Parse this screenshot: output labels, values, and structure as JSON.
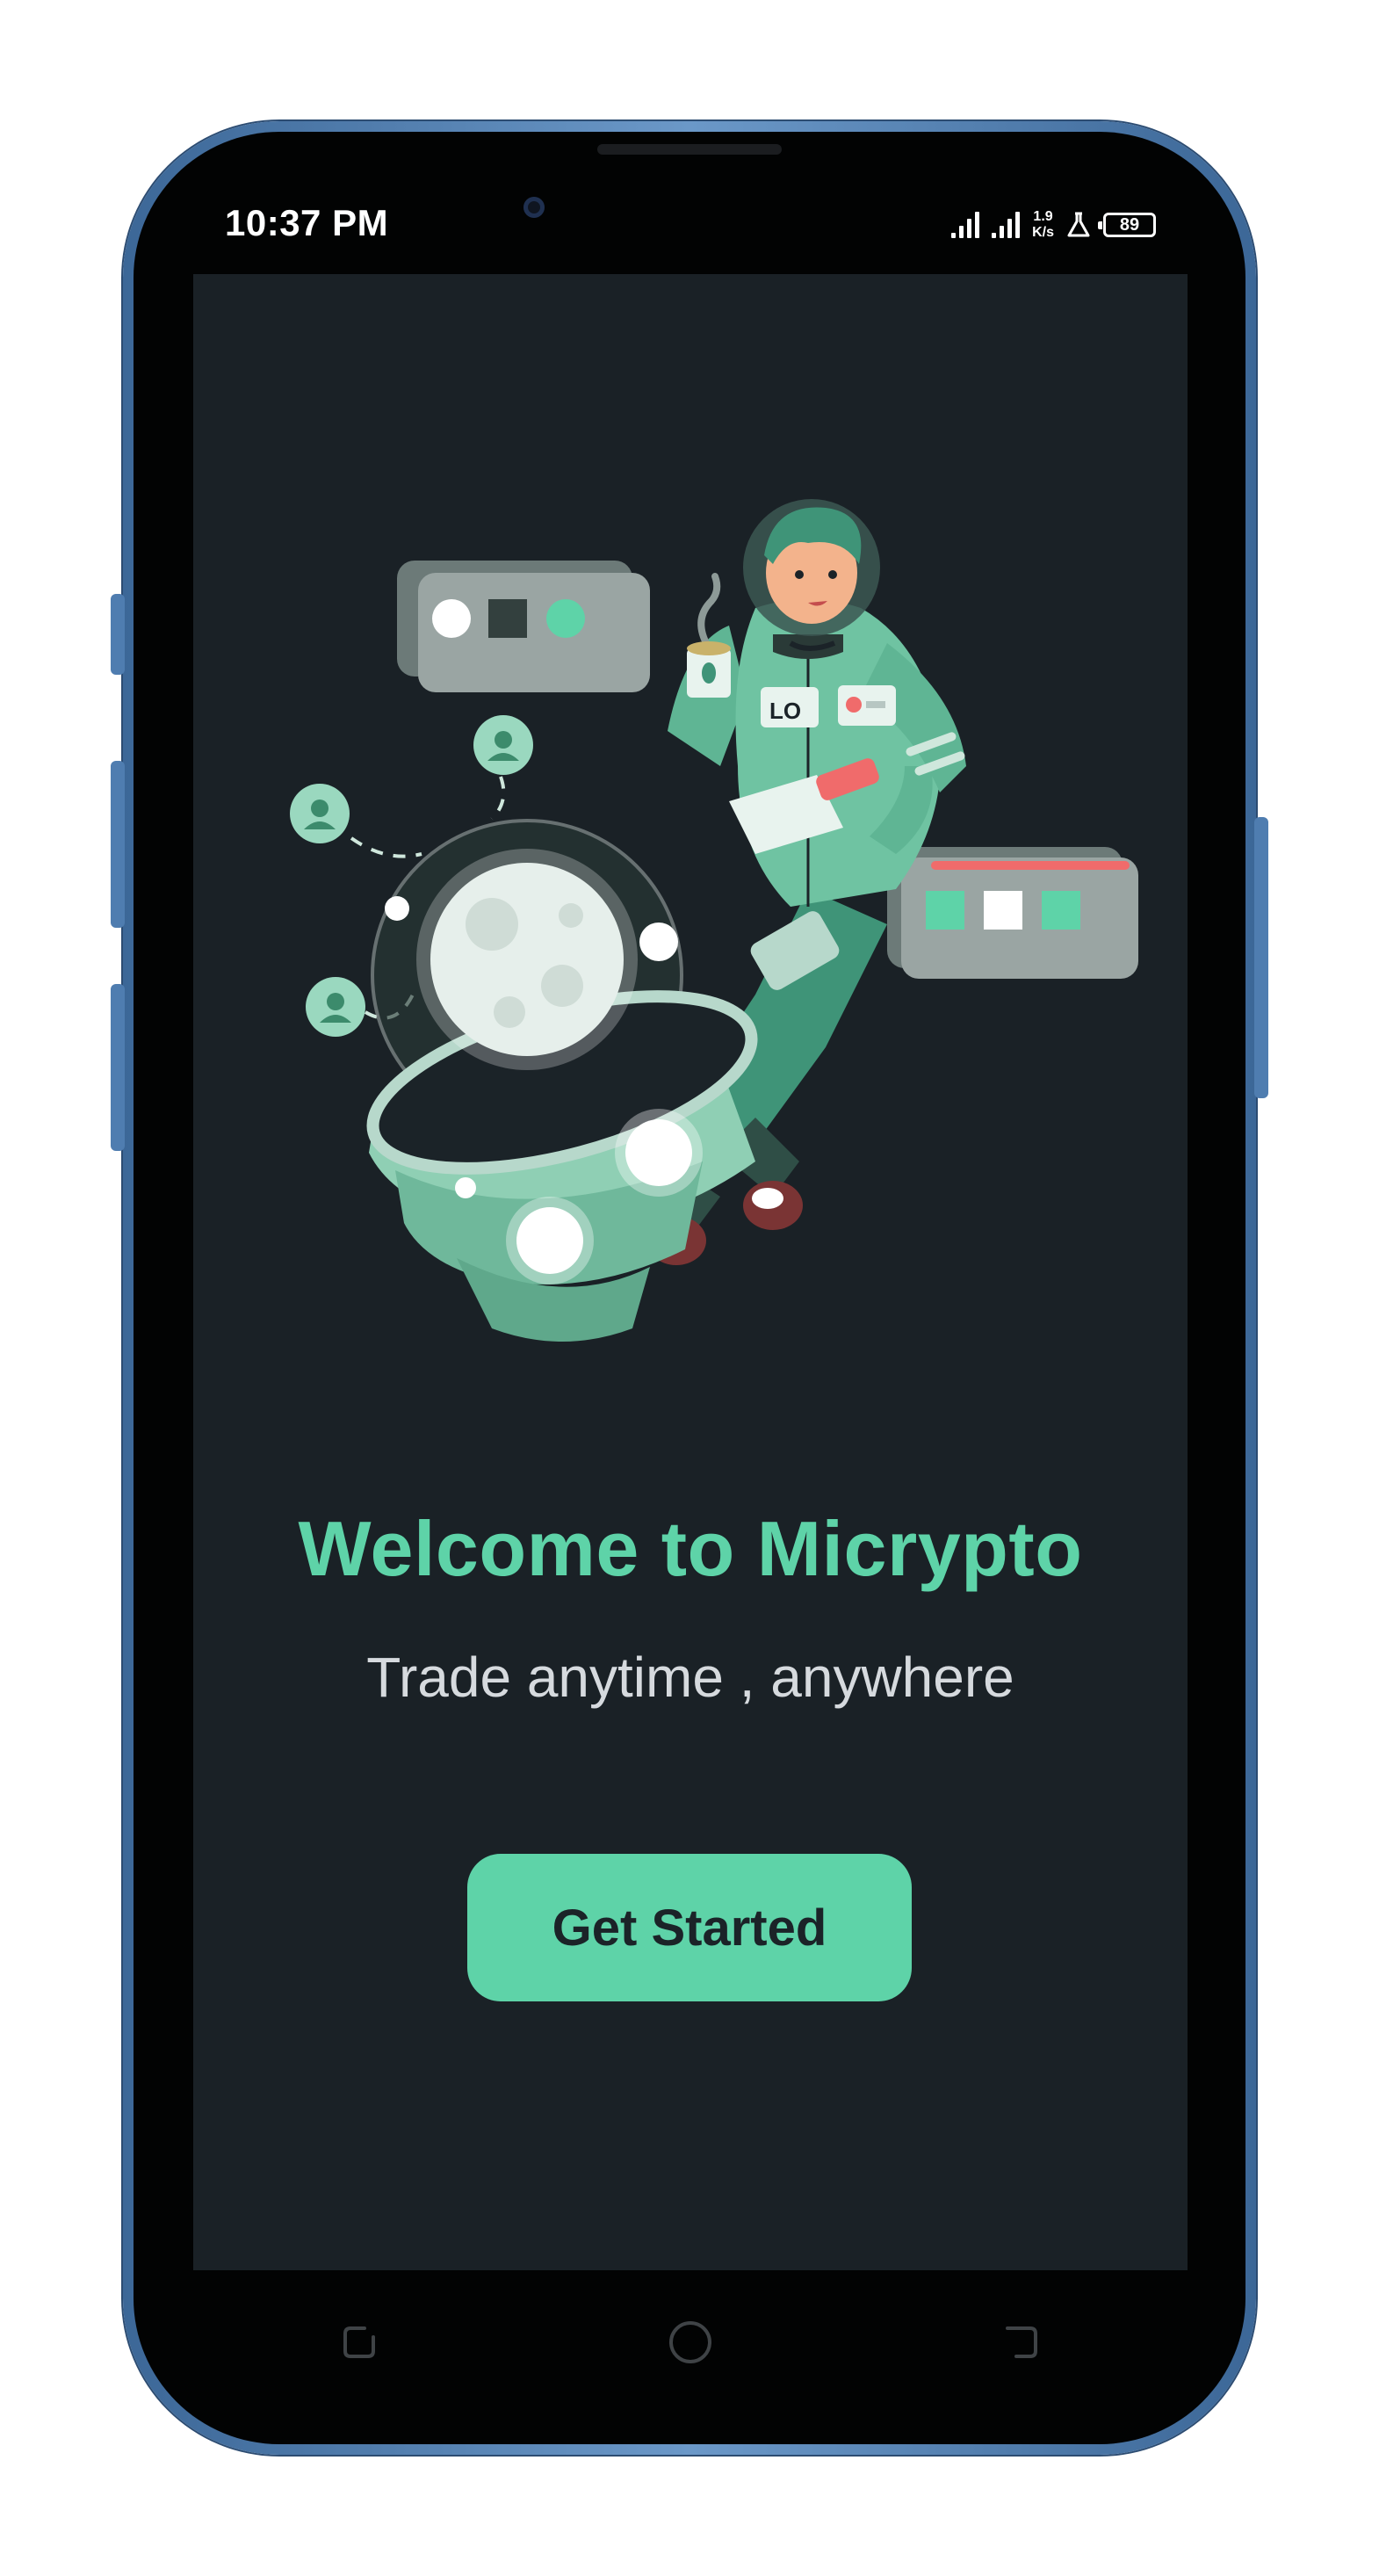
{
  "status_bar": {
    "time": "10:37 PM",
    "net_speed_value": "1.9",
    "net_speed_unit": "K/s",
    "battery": "89",
    "icons": [
      "signal-icon",
      "signal-icon",
      "flask-icon",
      "battery-icon"
    ]
  },
  "welcome": {
    "title": "Welcome to Micrypto",
    "subtitle": "Trade anytime , anywhere",
    "button_label": "Get Started"
  },
  "illustration": {
    "badge_text": "LO",
    "icons": [
      "astronaut-illustration",
      "moon-capsule-illustration",
      "user-bubble-icon",
      "card-panel-icon",
      "coffee-cup-icon"
    ]
  },
  "nav_bar": {
    "icons": [
      "recents-icon",
      "home-icon",
      "back-icon"
    ]
  },
  "colors": {
    "screen_background": "#1a2126",
    "accent": "#5ed3a8",
    "subtitle": "#d6dade",
    "button_text": "#1b2328",
    "phone_frame": "#4f7db0"
  }
}
